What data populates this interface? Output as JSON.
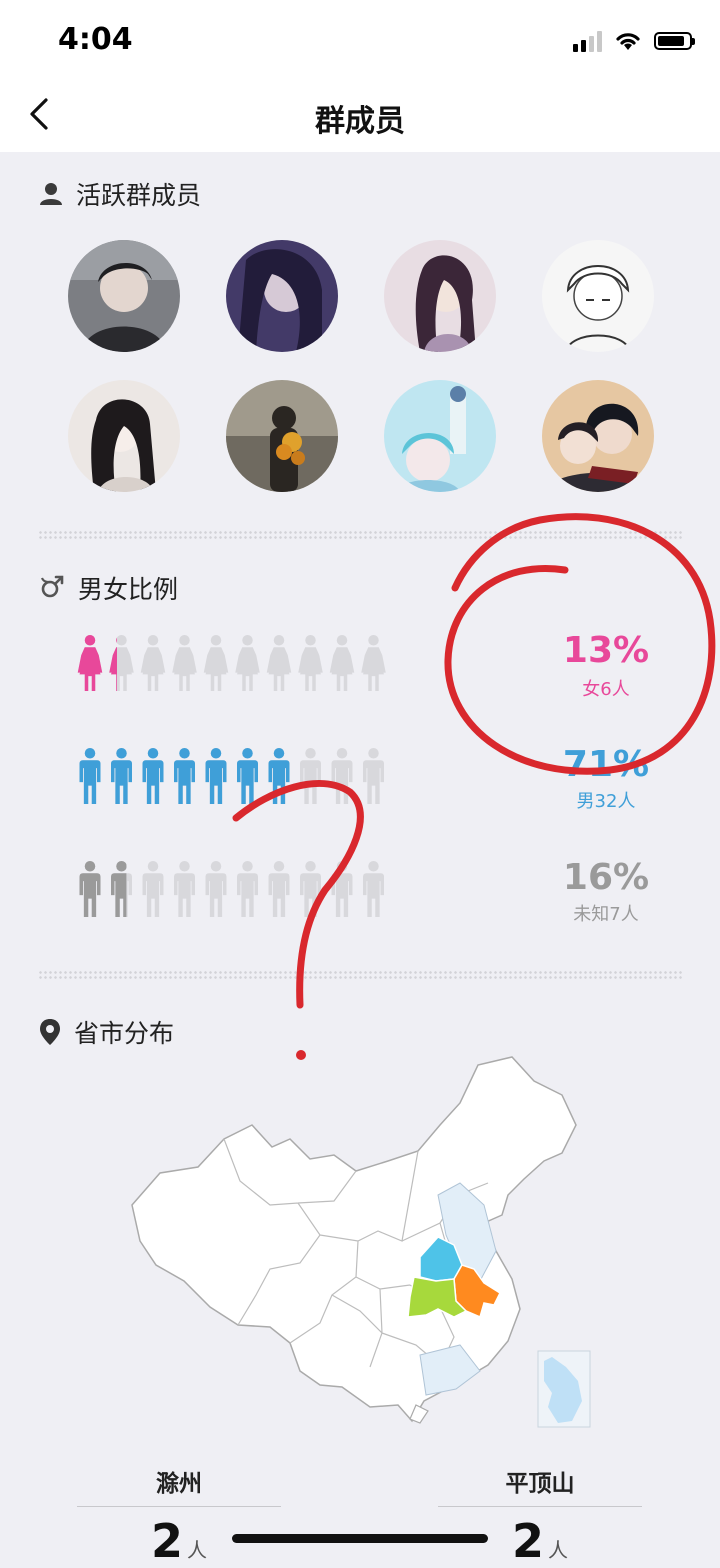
{
  "status_bar": {
    "time": "4:04"
  },
  "nav": {
    "title": "群成员"
  },
  "active_members": {
    "title": "活跃群成员",
    "avatars": [
      {
        "name": "avatar-1",
        "bg": "#6d6f74"
      },
      {
        "name": "avatar-2",
        "bg": "#4b4270"
      },
      {
        "name": "avatar-3",
        "bg": "#c9b6be"
      },
      {
        "name": "avatar-4",
        "bg": "#f2f2f2"
      },
      {
        "name": "avatar-5",
        "bg": "#dcd5d2"
      },
      {
        "name": "avatar-6",
        "bg": "#8b8476"
      },
      {
        "name": "avatar-7",
        "bg": "#9fd5e6"
      },
      {
        "name": "avatar-8",
        "bg": "#3d3b44"
      }
    ]
  },
  "gender_ratio": {
    "title": "男女比例",
    "rows": [
      {
        "key": "female",
        "percent": "13%",
        "label": "女6人",
        "color": "#e8489a",
        "fraction": 0.13
      },
      {
        "key": "male",
        "percent": "71%",
        "label": "男32人",
        "color": "#3f9fd8",
        "fraction": 0.71
      },
      {
        "key": "unknown",
        "percent": "16%",
        "label": "未知7人",
        "color": "#9a9a9a",
        "fraction": 0.16
      }
    ]
  },
  "region": {
    "title": "省市分布",
    "highlight_colors": [
      "#4ec3e8",
      "#ff8a1f",
      "#a7d93c"
    ],
    "cities": [
      {
        "name": "滁州",
        "count": "2",
        "unit": "人"
      },
      {
        "name": "平顶山",
        "count": "2",
        "unit": "人"
      }
    ]
  }
}
